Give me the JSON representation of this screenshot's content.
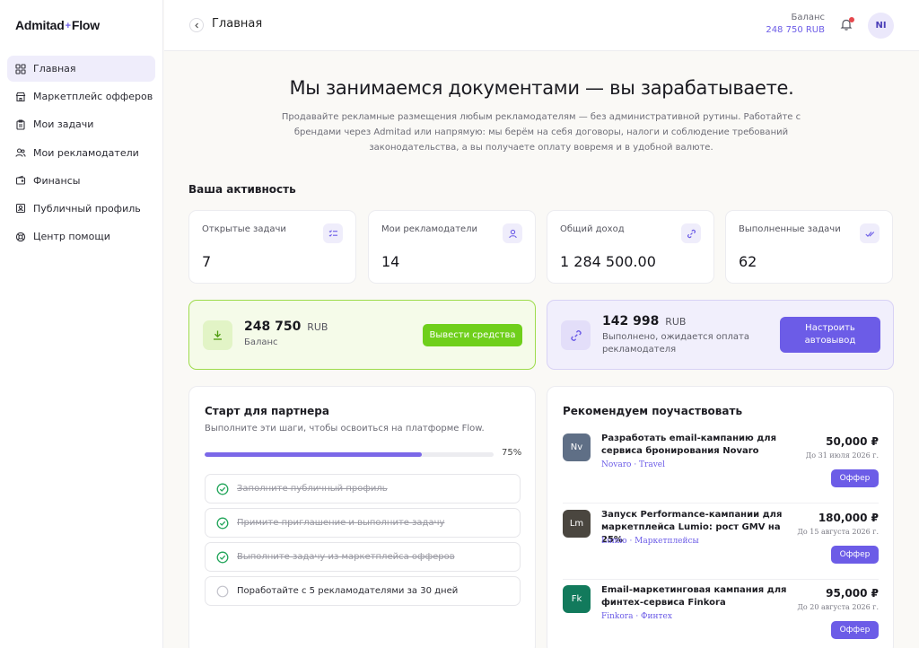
{
  "brand": {
    "name_left": "Admitad",
    "name_right": "Flow",
    "separator": "+"
  },
  "sidebar": {
    "items": [
      {
        "label": "Главная",
        "icon": "grid-icon",
        "active": true
      },
      {
        "label": "Маркетплейс офферов",
        "icon": "store-icon"
      },
      {
        "label": "Мои задачи",
        "icon": "clipboard-icon"
      },
      {
        "label": "Мои рекламодатели",
        "icon": "users-icon"
      },
      {
        "label": "Финансы",
        "icon": "wallet-icon"
      },
      {
        "label": "Публичный профиль",
        "icon": "profile-card-icon"
      },
      {
        "label": "Центр помощи",
        "icon": "lifebuoy-icon"
      }
    ]
  },
  "header": {
    "title": "Главная",
    "balance_label": "Баланс",
    "balance_value": "248 750 RUB",
    "avatar_initials": "NI"
  },
  "hero": {
    "title": "Мы занимаемся документами — вы зарабатываете.",
    "subtitle": "Продавайте рекламные размещения любым рекламодателям — без административной рутины. Работайте с брендами через Admitad или напрямую: мы берём на себя договоры, налоги и соблюдение требований законодательства, а вы получаете оплату вовремя и в удобной валюте."
  },
  "activity": {
    "title": "Ваша активность",
    "stats": [
      {
        "label": "Открытые задачи",
        "value": "7",
        "icon": "tasks-icon"
      },
      {
        "label": "Мои рекламодатели",
        "value": "14",
        "icon": "user-icon"
      },
      {
        "label": "Общий доход",
        "value": "1 284 500.00",
        "icon": "link-icon"
      },
      {
        "label": "Выполненные задачи",
        "value": "62",
        "icon": "double-check-icon"
      }
    ]
  },
  "balance_panel": {
    "amount": "248 750",
    "currency": "RUB",
    "label": "Баланс",
    "button": "Вывести средства"
  },
  "pending_panel": {
    "amount": "142 998",
    "currency": "RUB",
    "label": "Выполнено, ожидается оплата рекламодателя",
    "button": "Настроить автовывод"
  },
  "onboarding": {
    "title": "Старт для партнера",
    "subtitle": "Выполните эти шаги, чтобы освоиться на платформе Flow.",
    "progress": 0.75,
    "progress_label": "75%",
    "steps": [
      {
        "text": "Заполните публичный профиль",
        "done": true
      },
      {
        "text": "Примите приглашение и выполните задачу",
        "done": true
      },
      {
        "text": "Выполните задачу из маркетплейса офферов",
        "done": true
      },
      {
        "text": "Поработайте с 5 рекламодателями за 30 дней",
        "done": false
      }
    ]
  },
  "recommended": {
    "title": "Рекомендуем поучаствовать",
    "offers": [
      {
        "initials": "Nv",
        "color": "#5f6f86",
        "title": "Разработать email-кампанию для сервиса бронирования Novaro",
        "meta": "Novaro · Travel",
        "price": "50,000 ₽",
        "date": "До 31 июля 2026 г.",
        "button": "Оффер"
      },
      {
        "initials": "Lm",
        "color": "#4a463f",
        "title": "Запуск Performance-кампании для маркетплейса Lumio: рост GMV на 25%",
        "meta": "Lumio · Маркетплейсы",
        "price": "180,000 ₽",
        "date": "До 15 августа 2026 г.",
        "button": "Оффер"
      },
      {
        "initials": "Fk",
        "color": "#127a5c",
        "title": "Email-маркетинговая кампания для финтех-сервиса Finkora",
        "meta": "Finkora · Финтех",
        "price": "95,000 ₽",
        "date": "До 20 августа 2026 г.",
        "button": "Оффер"
      }
    ]
  },
  "colors": {
    "accent": "#6c5ce7",
    "green": "#6fcf1b",
    "success": "#22a55a"
  }
}
